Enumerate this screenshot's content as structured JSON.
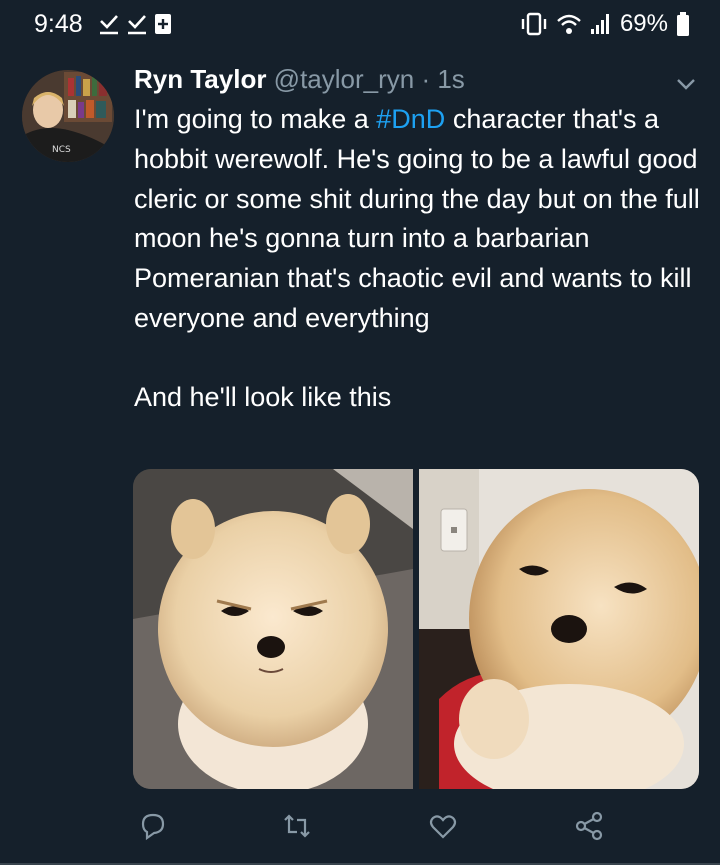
{
  "status_bar": {
    "time": "9:48",
    "battery": "69%",
    "icons": [
      "check-download-icon",
      "check-download-icon",
      "plus-box-icon",
      "vibrate-icon",
      "wifi-icon",
      "signal-icon",
      "battery-icon"
    ]
  },
  "tweet": {
    "name": "Ryn Taylor",
    "handle": "@taylor_ryn · 1s",
    "text_before_hashtag": "I'm going to make a ",
    "hashtag": "#DnD",
    "text_after_hashtag": " character that's a hobbit werewolf. He's going to be a lawful good cleric or some shit during the day but on the full moon he's gonna turn into a barbarian Pomeranian that's chaotic evil and wants to kill everyone and everything",
    "text_para2": "And he'll look like this",
    "media": [
      "photo-pomeranian-1",
      "photo-pomeranian-2"
    ],
    "actions": [
      "reply-icon",
      "retweet-icon",
      "like-icon",
      "share-icon"
    ]
  },
  "colors": {
    "background": "#15202b",
    "hashtag": "#1da1f2",
    "secondary_text": "#8899a6"
  }
}
